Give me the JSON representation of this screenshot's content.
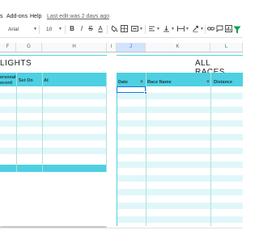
{
  "menu": {
    "items": [
      "s",
      "Add-ons",
      "Help"
    ],
    "last_edit": "Last edit was 2 days ago"
  },
  "toolbar": {
    "font": "Arial",
    "font_size": "10",
    "bold": "B",
    "italic": "I",
    "strikethrough": "S",
    "text_color": "A",
    "sigma": "Σ"
  },
  "columns": [
    "F",
    "G",
    "H",
    "I",
    "J",
    "K",
    "L"
  ],
  "left_table": {
    "title": "LIGHTS",
    "headers": [
      "ersonal\necord",
      "Set On",
      "At"
    ]
  },
  "right_table": {
    "title": "ALL RACES",
    "headers": [
      "Date",
      "Race Name",
      "Distance"
    ]
  }
}
